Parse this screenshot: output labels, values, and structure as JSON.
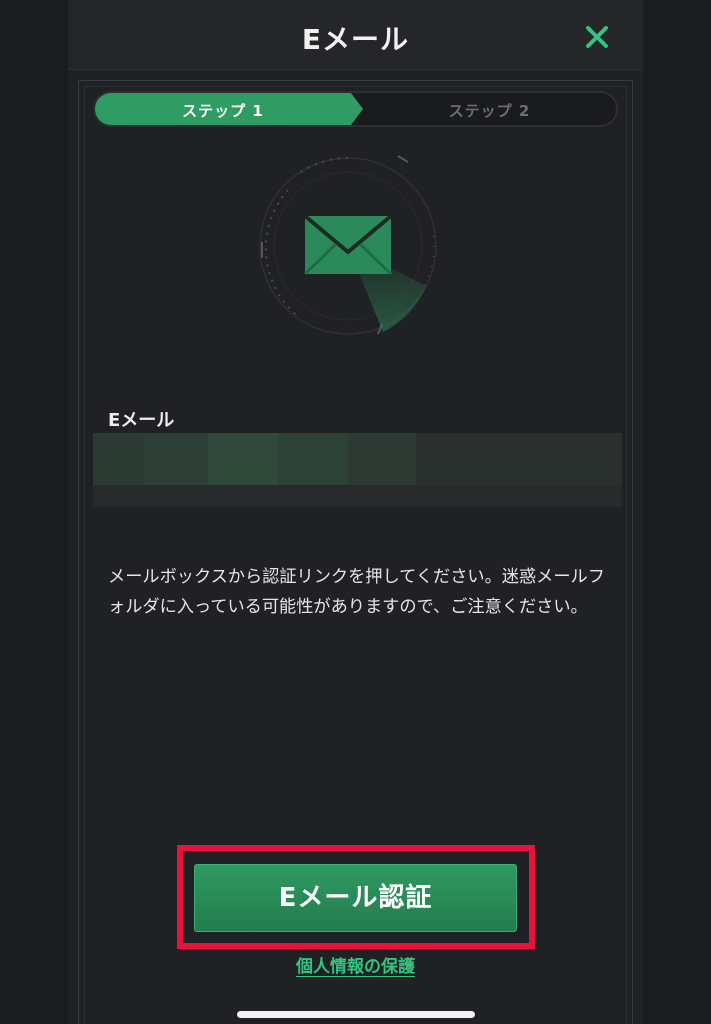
{
  "header": {
    "title": "Eメール",
    "close_icon": "close-x-icon",
    "accent_color": "#35c47f"
  },
  "stepper": {
    "steps": [
      {
        "label": "ステップ 1",
        "active": true
      },
      {
        "label": "ステップ 2",
        "active": false
      }
    ],
    "active_color": "#2e9c63"
  },
  "illustration": {
    "icon": "envelope-radar-icon"
  },
  "email": {
    "label": "Eメール",
    "value_obscured": true
  },
  "notice": {
    "text": "メールボックスから認証リンクを押してください。迷惑メールフォルダに入っている可能性がありますので、ご注意ください。"
  },
  "actions": {
    "verify_label": "Eメール認証",
    "privacy_link": "個人情報の保護",
    "highlight_color": "#e8123a"
  }
}
